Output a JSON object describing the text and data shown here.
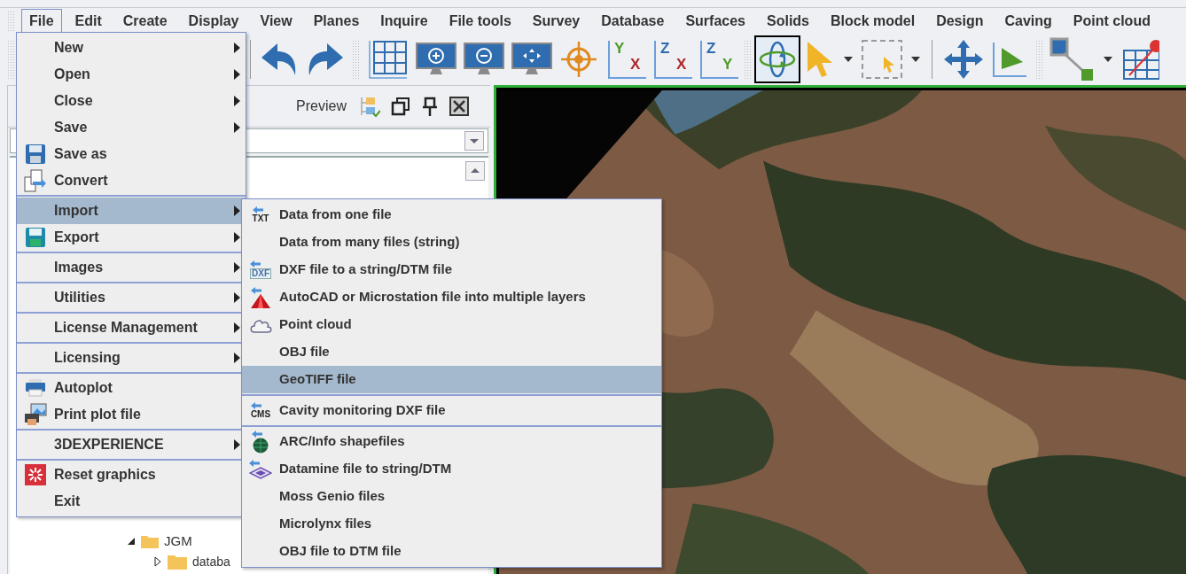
{
  "menubar": [
    {
      "label": "File",
      "selected": true
    },
    {
      "label": "Edit",
      "selected": false
    },
    {
      "label": "Create",
      "selected": false
    },
    {
      "label": "Display",
      "selected": false
    },
    {
      "label": "View",
      "selected": false
    },
    {
      "label": "Planes",
      "selected": false
    },
    {
      "label": "Inquire",
      "selected": false
    },
    {
      "label": "File tools",
      "selected": false
    },
    {
      "label": "Survey",
      "selected": false
    },
    {
      "label": "Database",
      "selected": false
    },
    {
      "label": "Surfaces",
      "selected": false
    },
    {
      "label": "Solids",
      "selected": false
    },
    {
      "label": "Block model",
      "selected": false
    },
    {
      "label": "Design",
      "selected": false
    },
    {
      "label": "Caving",
      "selected": false
    },
    {
      "label": "Point cloud",
      "selected": false
    }
  ],
  "toolbar": [
    {
      "kind": "undo",
      "selected": false
    },
    {
      "kind": "redo",
      "selected": false
    },
    {
      "kind": "grip"
    },
    {
      "kind": "grid",
      "selected": false
    },
    {
      "kind": "zoom-in",
      "selected": false
    },
    {
      "kind": "zoom-out",
      "selected": false
    },
    {
      "kind": "fit",
      "selected": false
    },
    {
      "kind": "target",
      "selected": false
    },
    {
      "kind": "axes",
      "selected": false,
      "labels": [
        {
          "text": "Y",
          "color": "#4f9a2a"
        },
        {
          "text": "X",
          "color": "#b0282c"
        }
      ]
    },
    {
      "kind": "axes",
      "selected": false,
      "labels": [
        {
          "text": "Z",
          "color": "#2f6db0"
        },
        {
          "text": "X",
          "color": "#b0282c"
        }
      ]
    },
    {
      "kind": "axes",
      "selected": false,
      "labels": [
        {
          "text": "Z",
          "color": "#2f6db0"
        },
        {
          "text": "Y",
          "color": "#4f9a2a"
        }
      ]
    },
    {
      "kind": "grip"
    },
    {
      "kind": "rotate",
      "selected": true
    },
    {
      "kind": "pointer",
      "selected": false
    },
    {
      "kind": "dropdown",
      "selected": false
    },
    {
      "kind": "box-select",
      "selected": false
    },
    {
      "kind": "dropdown",
      "selected": false
    },
    {
      "kind": "divider"
    },
    {
      "kind": "move",
      "selected": false
    },
    {
      "kind": "triangle",
      "selected": false
    },
    {
      "kind": "grip"
    },
    {
      "kind": "link",
      "selected": false
    },
    {
      "kind": "dropdown",
      "selected": false
    },
    {
      "kind": "grid-pencil",
      "selected": false
    }
  ],
  "panel": {
    "title": "Preview",
    "tree": [
      {
        "label": "JGM",
        "expanded": true,
        "children": [
          {
            "label": "databa",
            "expanded": false
          }
        ]
      }
    ]
  },
  "file_menu": {
    "groups": [
      [
        {
          "label": "New",
          "selected": false,
          "submenu": true
        },
        {
          "label": "Open",
          "selected": false,
          "submenu": true
        },
        {
          "label": "Close",
          "selected": false,
          "submenu": true
        },
        {
          "label": "Save",
          "selected": false,
          "submenu": true
        },
        {
          "label": "Save as",
          "selected": false,
          "submenu": false
        },
        {
          "label": "Convert",
          "selected": false,
          "submenu": false
        }
      ],
      [
        {
          "label": "Import",
          "selected": true,
          "submenu": true
        },
        {
          "label": "Export",
          "selected": false,
          "submenu": true
        }
      ],
      [
        {
          "label": "Images",
          "selected": false,
          "submenu": true
        }
      ],
      [
        {
          "label": "Utilities",
          "selected": false,
          "submenu": true
        }
      ],
      [
        {
          "label": "License Management",
          "selected": false,
          "submenu": true
        }
      ],
      [
        {
          "label": "Licensing",
          "selected": false,
          "submenu": true
        }
      ],
      [
        {
          "label": "Autoplot",
          "selected": false,
          "submenu": false
        },
        {
          "label": "Print plot file",
          "selected": false,
          "submenu": false
        }
      ],
      [
        {
          "label": "3DEXPERIENCE",
          "selected": false,
          "submenu": true
        }
      ],
      [
        {
          "label": "Reset graphics",
          "selected": false,
          "submenu": false
        },
        {
          "label": "Exit",
          "selected": false,
          "submenu": false
        }
      ]
    ]
  },
  "import_submenu": {
    "groups": [
      [
        {
          "label": "Data from one file",
          "selected": false,
          "icon_text": "TXT"
        },
        {
          "label": "Data from many files (string)",
          "selected": false
        },
        {
          "label": "DXF file to a string/DTM file",
          "selected": false,
          "icon_text": "DXF"
        },
        {
          "label": "AutoCAD or Microstation file into multiple layers",
          "selected": false
        },
        {
          "label": "Point cloud",
          "selected": false
        },
        {
          "label": "OBJ file",
          "selected": false
        },
        {
          "label": "GeoTIFF file",
          "selected": true
        }
      ],
      [
        {
          "label": "Cavity monitoring DXF file",
          "selected": false,
          "icon_text": "CMS"
        }
      ],
      [
        {
          "label": "ARC/Info shapefiles",
          "selected": false
        },
        {
          "label": "Datamine file to string/DTM",
          "selected": false
        },
        {
          "label": "Moss Genio files",
          "selected": false
        },
        {
          "label": "Microlynx files",
          "selected": false
        },
        {
          "label": "OBJ file to DTM file",
          "selected": false
        }
      ]
    ]
  }
}
